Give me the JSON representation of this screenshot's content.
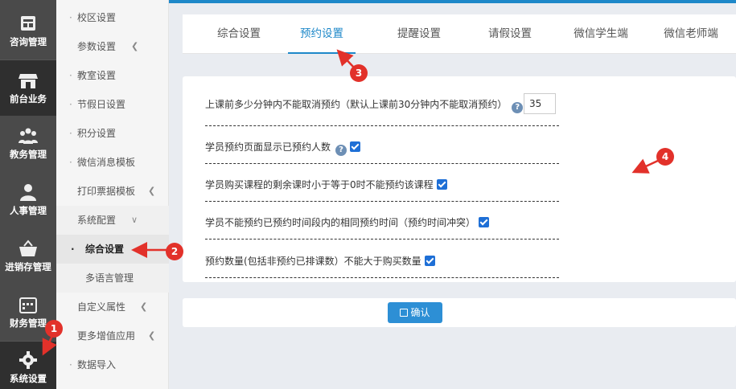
{
  "rail": {
    "items": [
      {
        "label": "咨询管理",
        "icon": "consult-icon"
      },
      {
        "label": "前台业务",
        "icon": "storefront-icon"
      },
      {
        "label": "教务管理",
        "icon": "people-group-icon"
      },
      {
        "label": "人事管理",
        "icon": "person-icon"
      },
      {
        "label": "进销存管理",
        "icon": "basket-icon"
      },
      {
        "label": "财务管理",
        "icon": "calendar-icon"
      },
      {
        "label": "系统设置",
        "icon": "gear-icon"
      }
    ]
  },
  "menu": {
    "items": [
      {
        "label": "校区设置"
      },
      {
        "label": "参数设置"
      },
      {
        "label": "教室设置"
      },
      {
        "label": "节假日设置"
      },
      {
        "label": "积分设置"
      },
      {
        "label": "微信消息模板"
      },
      {
        "label": "打印票据模板"
      },
      {
        "label": "系统配置"
      },
      {
        "label": "综合设置"
      },
      {
        "label": "多语言管理"
      },
      {
        "label": "自定义属性"
      },
      {
        "label": "更多增值应用"
      },
      {
        "label": "数据导入"
      }
    ]
  },
  "tabs": [
    {
      "label": "综合设置"
    },
    {
      "label": "预约设置"
    },
    {
      "label": "提醒设置"
    },
    {
      "label": "请假设置"
    },
    {
      "label": "微信学生端"
    },
    {
      "label": "微信老师端"
    }
  ],
  "settings": {
    "cancel_label": "上课前多少分钟内不能取消预约（默认上课前30分钟内不能取消预约）",
    "cancel_value": "35",
    "show_count_label": "学员预约页面显示已预约人数",
    "show_count_checked": true,
    "zero_hours_label": "学员购买课程的剩余课时小于等于0时不能预约该课程",
    "zero_hours_checked": true,
    "conflict_label": "学员不能预约已预约时间段内的相同预约时间（预约时间冲突）",
    "conflict_checked": true,
    "max_count_label": "预约数量(包括非预约已排课数）不能大于购买数量",
    "max_count_checked": true
  },
  "confirm_label": "确认",
  "annotations": [
    "1",
    "2",
    "3",
    "4"
  ],
  "colors": {
    "accent": "#1e88c9",
    "annotation": "#e2312a",
    "rail": "#4a4a4a"
  }
}
